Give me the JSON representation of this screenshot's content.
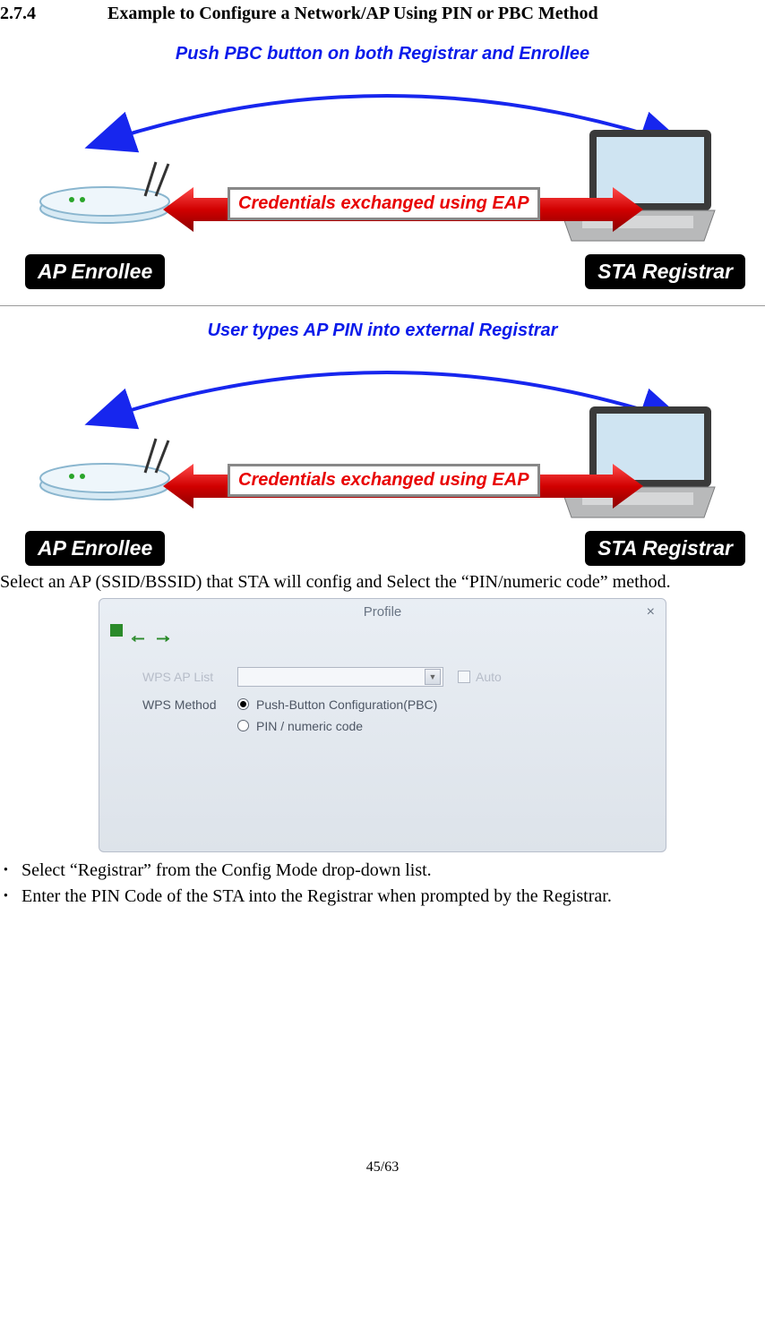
{
  "section": {
    "number": "2.7.4",
    "title": "Example to Configure a Network/AP Using PIN or PBC Method"
  },
  "diagram1": {
    "blue_title": "Push PBC button on both Registrar and Enrollee",
    "red_label": "Credentials exchanged using EAP",
    "left_label": "AP Enrollee",
    "right_label": "STA Registrar"
  },
  "diagram2": {
    "blue_title": "User types AP PIN into external Registrar",
    "red_label": "Credentials exchanged using EAP",
    "left_label": "AP Enrollee",
    "right_label": "STA Registrar"
  },
  "para_after_diagrams": "Select an AP (SSID/BSSID) that STA will config and Select the “PIN/numeric code” method.",
  "ui": {
    "title": "Profile",
    "close": "×",
    "wps_ap_list_label": "WPS AP List",
    "auto_label": "Auto",
    "wps_method_label": "WPS Method",
    "radio_pbc": "Push-Button Configuration(PBC)",
    "radio_pin": "PIN / numeric code"
  },
  "bullets": [
    "Select “Registrar” from the Config Mode drop-down list.",
    "Enter the PIN Code of the STA into the Registrar when prompted by the Registrar."
  ],
  "page_number": "45/63"
}
